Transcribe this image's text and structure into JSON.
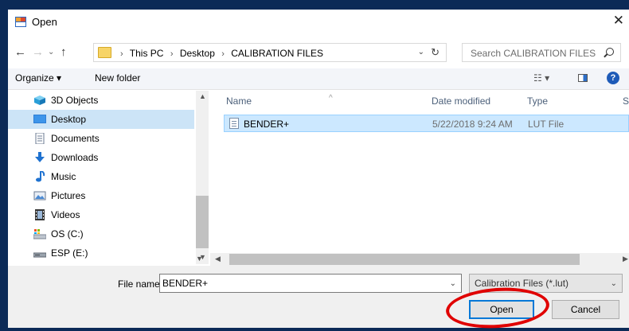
{
  "window": {
    "title": "Open",
    "close_glyph": "✕"
  },
  "nav": {
    "back_glyph": "←",
    "forward_glyph": "→",
    "history_glyph": "⌄",
    "up_glyph": "↑",
    "breadcrumbs": [
      "This PC",
      "Desktop",
      "CALIBRATION FILES"
    ],
    "breadcrumb_sep": "›",
    "refresh_glyph": "↻",
    "dropdown_glyph": "⌄"
  },
  "search": {
    "placeholder": "Search CALIBRATION FILES"
  },
  "toolbar": {
    "organize_label": "Organize ▾",
    "new_folder_label": "New folder",
    "view_glyph": "☷ ▾",
    "help_glyph": "?"
  },
  "sidebar": {
    "items": [
      {
        "label": "3D Objects",
        "icon": "cube-icon",
        "selected": false
      },
      {
        "label": "Desktop",
        "icon": "desktop-icon",
        "selected": true
      },
      {
        "label": "Documents",
        "icon": "documents-icon",
        "selected": false
      },
      {
        "label": "Downloads",
        "icon": "download-arrow-icon",
        "selected": false
      },
      {
        "label": "Music",
        "icon": "music-note-icon",
        "selected": false
      },
      {
        "label": "Pictures",
        "icon": "pictures-icon",
        "selected": false
      },
      {
        "label": "Videos",
        "icon": "film-icon",
        "selected": false
      },
      {
        "label": "OS (C:)",
        "icon": "drive-icon",
        "selected": false
      },
      {
        "label": "ESP (E:)",
        "icon": "removable-drive-icon",
        "selected": false
      }
    ]
  },
  "list": {
    "columns": [
      "Name",
      "Date modified",
      "Type",
      "S"
    ],
    "rows": [
      {
        "name": "BENDER+",
        "date": "5/22/2018 9:24 AM",
        "type": "LUT File",
        "selected": true
      }
    ]
  },
  "footer": {
    "file_name_label": "File name:",
    "file_name_value": "BENDER+",
    "filter_value": "Calibration Files (*.lut)",
    "open_label": "Open",
    "cancel_label": "Cancel"
  },
  "colors": {
    "accent": "#0078d7",
    "selection": "#cce8ff",
    "annotation": "#e00000"
  }
}
